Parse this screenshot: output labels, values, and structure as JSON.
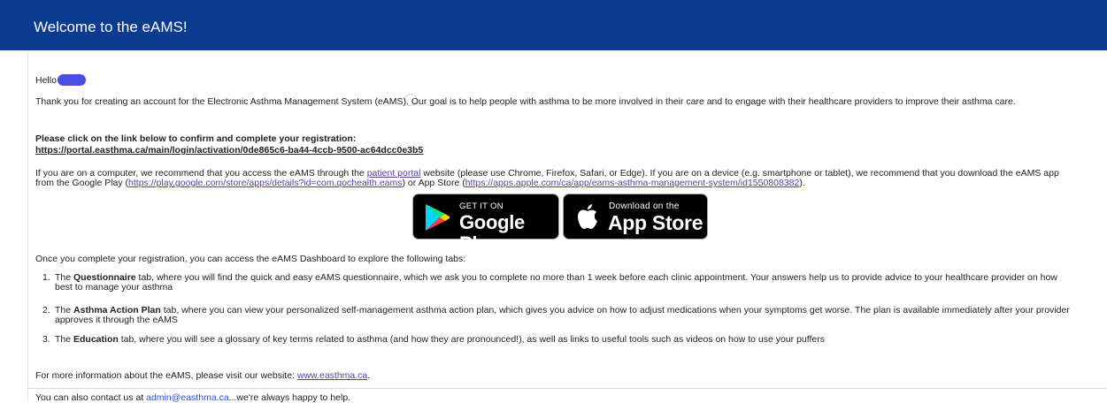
{
  "header": {
    "title": "Welcome to the eAMS!"
  },
  "greeting": {
    "hello": "Hello"
  },
  "intro": "Thank you for creating an account for the Electronic Asthma Management System (eAMS). Our goal is to help people with asthma to be more involved in their care and to engage with their healthcare providers to improve their asthma care.",
  "confirm": {
    "prompt": "Please click on the link below to confirm and complete your registration:",
    "link": "https://portal.easthma.ca/main/login/activation/0de865c6-ba44-4ccb-9500-ac64dcc0e3b5"
  },
  "device_info": {
    "part1": "If you are on a computer, we recommend that you access the eAMS through the ",
    "portal_link": "patient portal",
    "part2": " website (please use Chrome, Firefox, Safari, or Edge). If you are on a device (e.g. smartphone or tablet), we recommend that you download the eAMS app from the Google Play (",
    "google_link": "https://play.google.com/store/apps/details?id=com.qochealth.eams",
    "part3": ") or App Store (",
    "apple_link": "https://apps.apple.com/ca/app/eams-asthma-management-system/id1550808382",
    "part4": ")."
  },
  "badges": {
    "google_small": "GET IT ON",
    "google_big": "Google Play",
    "apple_small": "Download on the",
    "apple_big": "App Store"
  },
  "tabs_intro": "Once you complete your registration, you can access the eAMS Dashboard to explore the following tabs:",
  "tabs": [
    {
      "num": "1.",
      "pre": "The ",
      "name": "Questionnaire",
      "post": " tab, where you will find the quick and easy eAMS questionnaire, which we ask you to complete no more than 1 week before each clinic appointment. Your answers help us to provide advice to your healthcare provider on how best to manage your asthma"
    },
    {
      "num": "2.",
      "pre": "The ",
      "name": "Asthma Action Plan",
      "post": " tab, where you can view your personalized self-management asthma action plan, which gives you advice on how to adjust medications when your symptoms get worse. The plan is available immediately after your provider approves it through the eAMS"
    },
    {
      "num": "3.",
      "pre": "The ",
      "name": "Education",
      "post": " tab, where you will see a glossary of key terms related to asthma (and how they are pronounced!), as well as links to useful tools such as videos on how to use your puffers"
    }
  ],
  "more_info": {
    "text": "For more information about the eAMS, please visit our website: ",
    "link": "www.easthma.ca",
    "end": "."
  },
  "contact": {
    "text": "You can also contact us at ",
    "email": "admin@easthma.ca",
    "end": "...we're always happy to help."
  },
  "colors": {
    "header_bg": "#0b3b8f",
    "link": "#5b3ea3",
    "redaction": "#4a4de0"
  }
}
